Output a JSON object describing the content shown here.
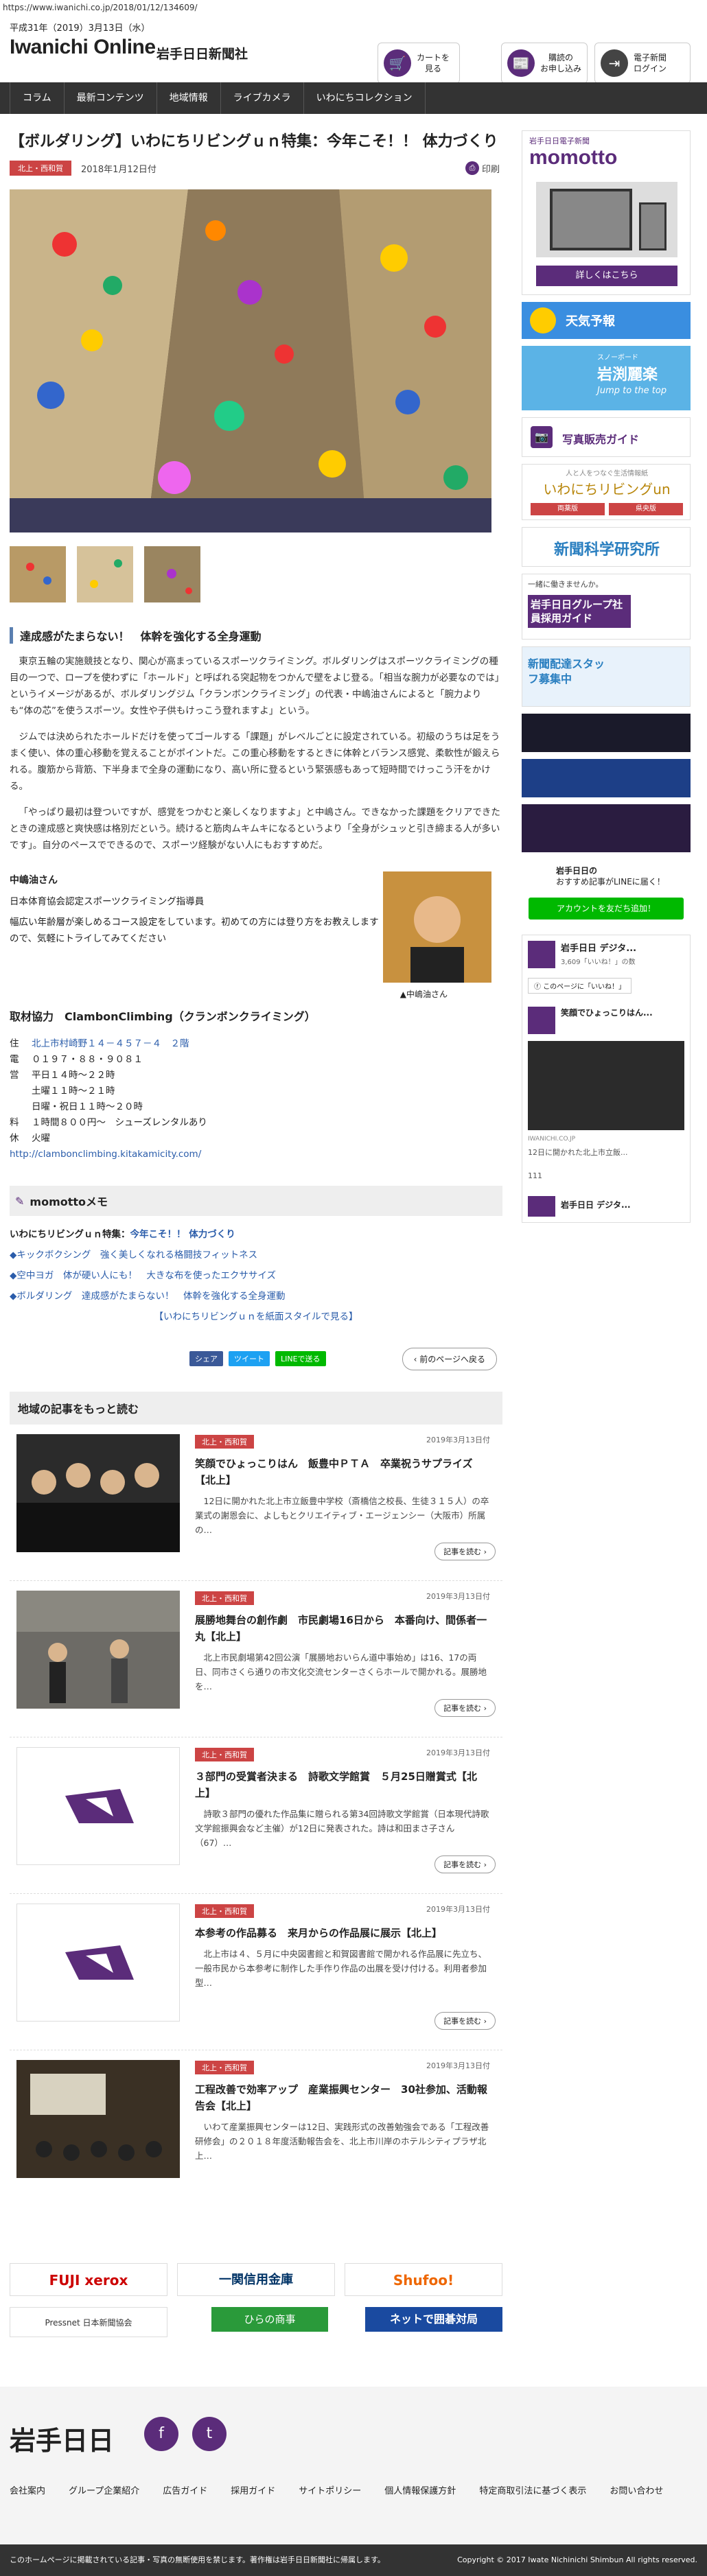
{
  "browser": {
    "url": "https://www.iwanichi.co.jp/2018/01/12/134609/"
  },
  "header": {
    "date": "平成31年（2019）3月13日（水）",
    "logo": "Iwanichi Online",
    "logo_jp": "岩手日日新聞社",
    "buttons": [
      {
        "label": "カートを\n見る",
        "color": "#5b2c7a"
      },
      {
        "label": "購読の\nお申し込み",
        "color": "#5b2c7a"
      },
      {
        "label": "電子新聞\nログイン",
        "color": "#444"
      }
    ]
  },
  "nav": [
    "コラム",
    "最新コンテンツ",
    "地域情報",
    "ライブカメラ",
    "いわにちコレクション"
  ],
  "article": {
    "title": "【ボルダリング】いわにちリビングｕｎ特集：今年こそ！！ 体力づくり",
    "category": "北上・西和賀",
    "date": "2018年1月12日付",
    "print": "印刷",
    "subheading": "達成感がたまらない！　体幹を強化する全身運動",
    "paragraphs": [
      "東京五輪の実施競技となり、関心が高まっているスポーツクライミング。ボルダリングはスポーツクライミングの種目の一つで、ロープを使わずに「ホールド」と呼ばれる突起物をつかんで壁をよじ登る。「相当な腕力が必要なのでは」というイメージがあるが、ボルダリングジム「クランボンクライミング」の代表・中嶋油さんによると「腕力よりも“体の芯”を使うスポーツ。女性や子供もけっこう登れますよ」という。",
      "ジムでは決められたホールドだけを使ってゴールする「課題」がレベルごとに設定されている。初級のうちは足をうまく使い、体の重心移動を覚えることがポイントだ。この重心移動をするときに体幹とバランス感覚、柔軟性が鍛えられる。腹筋から背筋、下半身まで全身の運動になり、高い所に登るという緊張感もあって短時間でけっこう汗をかける。",
      "「やっぱり最初は登ついですが、感覚をつかむと楽しくなりますよ」と中嶋さん。できなかった課題をクリアできたときの達成感と爽快感は格別だという。続けると筋肉ムキムキになるというより「全身がシュッと引き締まる人が多いです」。自分のペースでできるので、スポーツ経験がない人にもおすすめだ。"
    ],
    "profile": {
      "name": "中嶋油さん",
      "title": "日本体育協会認定スポーツクライミング指導員",
      "desc": "幅広い年齢層が楽しめるコース設定をしています。初めての方には登り方をお教えしますので、気軽にトライしてみてください",
      "caption": "▲中嶋油さん"
    },
    "coop": {
      "heading": "取材協力　ClambonClimbing（クランボンクライミング）",
      "rows": [
        {
          "k": "住",
          "v": "北上市村崎野１４－４５７－４　２階",
          "link": true
        },
        {
          "k": "電",
          "v": "０１９７・８８・９０８１",
          "link": false
        },
        {
          "k": "営",
          "v": "平日１４時～２２時",
          "link": false
        },
        {
          "k": "",
          "v": "土曜１１時～２１時",
          "link": false
        },
        {
          "k": "",
          "v": "日曜・祝日１１時～２０時",
          "link": false
        },
        {
          "k": "料",
          "v": "１時間８００円～　シューズレンタルあり",
          "link": false
        },
        {
          "k": "休",
          "v": "火曜",
          "link": false
        }
      ],
      "url": "http://clambonclimbing.kitakamicity.com/"
    }
  },
  "memo": {
    "heading": "momottoメモ",
    "lead_prefix": "いわにちリビングｕｎ特集：",
    "lead_link": "今年こそ！！ 体力づくり",
    "links": [
      "◆キックボクシング　強く美しくなれる格闘技フィットネス",
      "◆空中ヨガ　体が硬い人にも！　大きな布を使ったエクササイズ",
      "◆ボルダリング　達成感がたまらない！　体幹を強化する全身運動"
    ],
    "paper_link": "【いわにちリビングｕｎを紙面スタイルで見る】"
  },
  "share": {
    "facebook": "シェア",
    "twitter": "ツイート",
    "line": "LINEで送る",
    "back": "前のページへ戻る"
  },
  "more": {
    "heading": "地域の記事をもっと読む",
    "cards": [
      {
        "category": "北上・西和賀",
        "date": "2019年3月13日付",
        "title": "笑顔でひょっこりはん　飯豊中ＰＴＡ　卒業祝うサプライズ【北上】",
        "excerpt": "12日に開かれた北上市立飯豊中学校（斎橋信之校長、生徒３１５人）の卒業式の謝恩会に、よしもとクリエイティブ・エージェンシー（大阪市）所属の…",
        "more": "記事を読む",
        "img": "photo"
      },
      {
        "category": "北上・西和賀",
        "date": "2019年3月13日付",
        "title": "展勝地舞台の創作劇　市民劇場16日から　本番向け、間係者一丸【北上】",
        "excerpt": "北上市民劇場第42回公演「展勝地おいらん道中事始め」は16、17の両日、同市さくら通りの市文化交流センターさくらホールで開かれる。展勝地を…",
        "more": "記事を読む",
        "img": "photo"
      },
      {
        "category": "北上・西和賀",
        "date": "2019年3月13日付",
        "title": "３部門の受賞者決まる　詩歌文学館賞　５月25日贈賞式【北上】",
        "excerpt": "詩歌３部門の優れた作品集に贈られる第34回詩歌文学館賞（日本現代詩歌文学館振興会など主催）が12日に発表された。詩は和田まさ子さん（67）…",
        "more": "記事を読む",
        "img": "logo"
      },
      {
        "category": "北上・西和賀",
        "date": "2019年3月13日付",
        "title": "本参考の作品募る　来月からの作品展に展示【北上】",
        "excerpt": "北上市は４、５月に中央図書館と和賀図書館で開かれる作品展に先立ち、一般市民から本参考に制作した手作り作品の出展を受け付ける。利用者参加型…",
        "more": "記事を読む",
        "img": "logo"
      },
      {
        "category": "北上・西和賀",
        "date": "2019年3月13日付",
        "title": "工程改善で効率アップ　産業振興センター　30社参加、活動報告会【北上】",
        "excerpt": "いわて産業振興センターは12日、実践形式の改善勉強会である「工程改善研修会」の２０１８年度活動報告会を、北上市川岸のホテルシティプラザ北上…",
        "more": "記事を読む",
        "img": "photo"
      }
    ]
  },
  "sidebar": {
    "momotto_title": "momotto",
    "momotto_sub": "岩手日日電子新聞",
    "momotto_cta": "詳しくはこちら",
    "weather": "天気予報",
    "iwabuchi_title": "岩渕麗楽",
    "iwabuchi_sub": "Jump to the top",
    "iwabuchi_pre": "スノーボード",
    "photo_sales": "写真販売ガイド",
    "living_title": "いわにちリビングun",
    "living_tabs": [
      "両薬版",
      "県央版"
    ],
    "living_pre": "人と人をつなぐ生活情報紙",
    "science": "新聞科学研究所",
    "recruit": "岩手日日グループ社員採用ガイド",
    "recruit_pre": "一緒に働きませんか。",
    "staff": "新聞配達スタッフ募集中",
    "line_title": "岩手日日の",
    "line_sub": "おすすめ記事がLINEに届く！",
    "line_btn": "アカウントを友だち追加！",
    "fb_name": "岩手日日 デジタ...",
    "fb_likes": "3,609「いいね！」の数",
    "fb_like_btn": "このページに「いいね！」",
    "fb_post_title": "笑顔でひょっこりはん...",
    "fb_post_sub": "12日に開かれた北上市立飯...",
    "fb_domain": "IWANICHI.CO.JP",
    "fb_counts": "111",
    "fb_name2": "岩手日日 デジタ..."
  },
  "footer_ads": [
    "FUJI xerox",
    "一関信用金庫",
    "Shufoo!",
    "Pressnet 日本新聞協会",
    "ひらの商事",
    "ネットで囲碁対局"
  ],
  "footer": {
    "logo": "岩手日日",
    "links": [
      "会社案内",
      "グループ企業紹介",
      "広告ガイド",
      "採用ガイド",
      "サイトポリシー",
      "個人情報保護方針",
      "特定商取引法に基づく表示",
      "お問い合わせ"
    ],
    "notice": "このホームページに掲載されている記事・写真の無断使用を禁じます。著作権は岩手日日新聞社に帰属します。",
    "copyright": "Copyright © 2017 Iwate Nichinichi Shimbun All rights reserved."
  }
}
